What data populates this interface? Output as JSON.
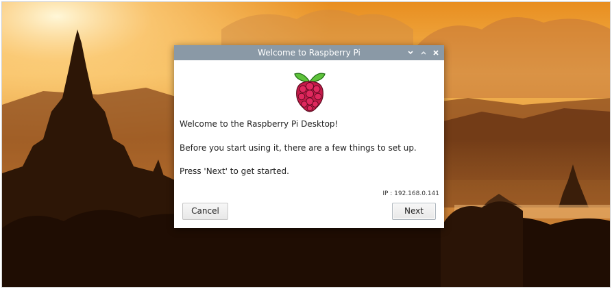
{
  "dialog": {
    "title": "Welcome to Raspberry Pi",
    "logo": "raspberry-pi-logo",
    "messages": [
      "Welcome to the Raspberry Pi Desktop!",
      "Before you start using it, there are a few things to set up.",
      "Press 'Next' to get started."
    ],
    "ip": "IP : 192.168.0.141",
    "buttons": {
      "cancel": "Cancel",
      "next": "Next"
    },
    "window_controls": {
      "minimize": "minimize-icon",
      "maximize": "maximize-icon",
      "close": "close-icon"
    }
  },
  "colors": {
    "titlebar": "#8a99a6",
    "dialog_bg": "#ffffff",
    "sky": "#f0a030",
    "silhouette": "#3a1e08"
  }
}
